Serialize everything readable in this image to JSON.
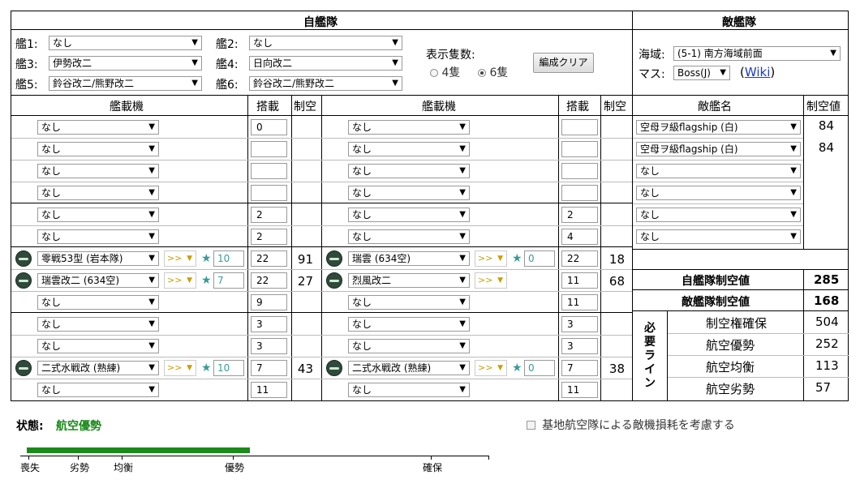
{
  "own_fleet": {
    "title": "自艦隊",
    "ships": [
      {
        "label": "艦1:",
        "value": "なし"
      },
      {
        "label": "艦2:",
        "value": "なし"
      },
      {
        "label": "艦3:",
        "value": "伊勢改二"
      },
      {
        "label": "艦4:",
        "value": "日向改二"
      },
      {
        "label": "艦5:",
        "value": "鈴谷改二/熊野改二"
      },
      {
        "label": "艦6:",
        "value": "鈴谷改二/熊野改二"
      }
    ],
    "count_label": "表示隻数:",
    "count_options": [
      "4隻",
      "6隻"
    ],
    "count_selected": "6隻",
    "clear_button": "編成クリア"
  },
  "enemy_fleet": {
    "title": "敵艦隊",
    "area_label": "海域:",
    "area_value": "(5-1) 南方海域前面",
    "node_label": "マス:",
    "node_value": "Boss(J)",
    "wiki_link": "Wiki",
    "headers": {
      "name": "敵艦名",
      "air": "制空値"
    },
    "ships": [
      {
        "name": "空母ヲ級flagship (白)",
        "air": "84"
      },
      {
        "name": "空母ヲ級flagship (白)",
        "air": "84"
      },
      {
        "name": "なし",
        "air": ""
      },
      {
        "name": "なし",
        "air": ""
      },
      {
        "name": "なし",
        "air": ""
      },
      {
        "name": "なし",
        "air": ""
      }
    ]
  },
  "equip_headers": {
    "equip": "艦載機",
    "slot": "搭載",
    "air": "制空"
  },
  "left_col": [
    {
      "equip": "なし",
      "slot": "0",
      "icon": false
    },
    {
      "equip": "なし",
      "slot": "",
      "icon": false
    },
    {
      "equip": "なし",
      "slot": "",
      "icon": false
    },
    {
      "equip": "なし",
      "slot": "",
      "icon": false
    },
    {
      "equip": "なし",
      "slot": "2",
      "icon": false
    },
    {
      "equip": "なし",
      "slot": "2",
      "icon": false
    },
    {
      "equip": "零戦53型 (岩本隊)",
      "slot": "22",
      "icon": true,
      "prof": ">>",
      "imp": "10",
      "air": "91"
    },
    {
      "equip": "瑞雲改二 (634空)",
      "slot": "22",
      "icon": true,
      "prof": ">>",
      "imp": "7",
      "air": "27"
    },
    {
      "equip": "なし",
      "slot": "9",
      "icon": false
    },
    {
      "equip": "なし",
      "slot": "3",
      "icon": false
    },
    {
      "equip": "なし",
      "slot": "3",
      "icon": false
    },
    {
      "equip": "二式水戦改 (熟練)",
      "slot": "7",
      "icon": true,
      "prof": ">>",
      "imp": "10",
      "air": "43"
    },
    {
      "equip": "なし",
      "slot": "11",
      "icon": false
    }
  ],
  "right_col": [
    {
      "equip": "なし",
      "slot": "",
      "icon": false
    },
    {
      "equip": "なし",
      "slot": "",
      "icon": false
    },
    {
      "equip": "なし",
      "slot": "",
      "icon": false
    },
    {
      "equip": "なし",
      "slot": "",
      "icon": false
    },
    {
      "equip": "なし",
      "slot": "2",
      "icon": false
    },
    {
      "equip": "なし",
      "slot": "4",
      "icon": false
    },
    {
      "equip": "瑞雲 (634空)",
      "slot": "22",
      "icon": true,
      "prof": ">>",
      "imp": "0",
      "air": "18"
    },
    {
      "equip": "烈風改二",
      "slot": "11",
      "icon": true,
      "prof": ">>",
      "imp": null,
      "air": "68"
    },
    {
      "equip": "なし",
      "slot": "11",
      "icon": false
    },
    {
      "equip": "なし",
      "slot": "3",
      "icon": false
    },
    {
      "equip": "なし",
      "slot": "3",
      "icon": false
    },
    {
      "equip": "二式水戦改 (熟練)",
      "slot": "7",
      "icon": true,
      "prof": ">>",
      "imp": "0",
      "air": "38"
    },
    {
      "equip": "なし",
      "slot": "11",
      "icon": false
    }
  ],
  "summary": {
    "own_label": "自艦隊制空値",
    "own_value": "285",
    "enemy_label": "敵艦隊制空値",
    "enemy_value": "168",
    "required_label": "必要ライン",
    "lines": [
      {
        "label": "制空権確保",
        "value": "504"
      },
      {
        "label": "航空優勢",
        "value": "252"
      },
      {
        "label": "航空均衡",
        "value": "113"
      },
      {
        "label": "航空劣勢",
        "value": "57"
      }
    ]
  },
  "status": {
    "label": "状態:",
    "value": "航空優勢",
    "color": "#1a8a1a",
    "bar_fraction": 0.46,
    "ticks": [
      "喪失",
      "劣勢",
      "均衡",
      "優勢",
      "確保"
    ]
  },
  "base_air": {
    "label": "基地航空隊による敵機損耗を考慮する",
    "checked": false
  }
}
